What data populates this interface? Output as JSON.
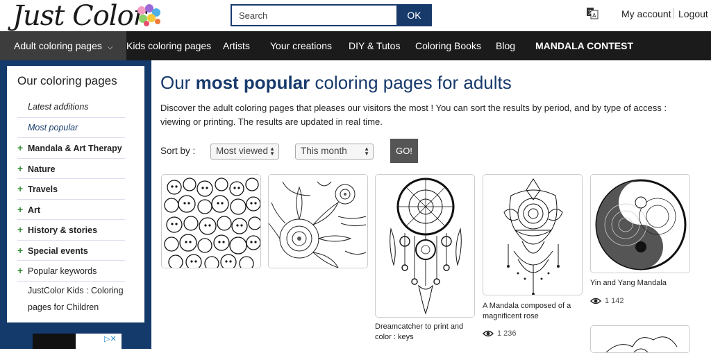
{
  "header": {
    "logo_text": "Just Color",
    "search": {
      "placeholder": "Search",
      "button_label": "OK"
    },
    "translate_icon": "translate-icon",
    "my_account": "My account",
    "logout": "Logout"
  },
  "nav": {
    "items": [
      {
        "label": "Adult coloring pages"
      },
      {
        "label": "Kids coloring pages"
      },
      {
        "label": "Artists"
      },
      {
        "label": "Your creations"
      },
      {
        "label": "DIY & Tutos"
      },
      {
        "label": "Coloring Books"
      },
      {
        "label": "Blog"
      },
      {
        "label": "MANDALA CONTEST"
      }
    ]
  },
  "sidebar": {
    "title": "Our coloring pages",
    "items": [
      {
        "label": "Latest additions"
      },
      {
        "label": "Most popular"
      },
      {
        "label": "Mandala & Art Therapy"
      },
      {
        "label": "Nature"
      },
      {
        "label": "Travels"
      },
      {
        "label": "Art"
      },
      {
        "label": "History & stories"
      },
      {
        "label": "Special events"
      },
      {
        "label": "Popular keywords"
      },
      {
        "label": "JustColor Kids : Coloring pages for Children"
      }
    ]
  },
  "main": {
    "title_prefix": "Our ",
    "title_bold": "most popular",
    "title_suffix": " coloring pages for adults",
    "intro": "Discover the adult coloring pages that pleases our visitors the most ! You can sort the results by period, and by type of access : viewing or printing. The results are updated in real time.",
    "sort_label": "Sort by :",
    "sort_select": "Most viewed",
    "period_select": "This month",
    "go_label": "GO!",
    "cards": [
      {
        "caption": "",
        "views": ""
      },
      {
        "caption": "",
        "views": ""
      },
      {
        "caption": "Dreamcatcher to print and color : keys",
        "views": ""
      },
      {
        "caption": "A Mandala composed of a magnificent rose",
        "views": "1 236"
      },
      {
        "caption": "Yin and Yang Mandala",
        "views": "1 142"
      },
      {
        "caption": "",
        "views": ""
      }
    ]
  },
  "colors": {
    "brand_navy": "#173a6b",
    "nav_bg": "#1b1b1b",
    "plus_green": "#2f8a2f"
  }
}
